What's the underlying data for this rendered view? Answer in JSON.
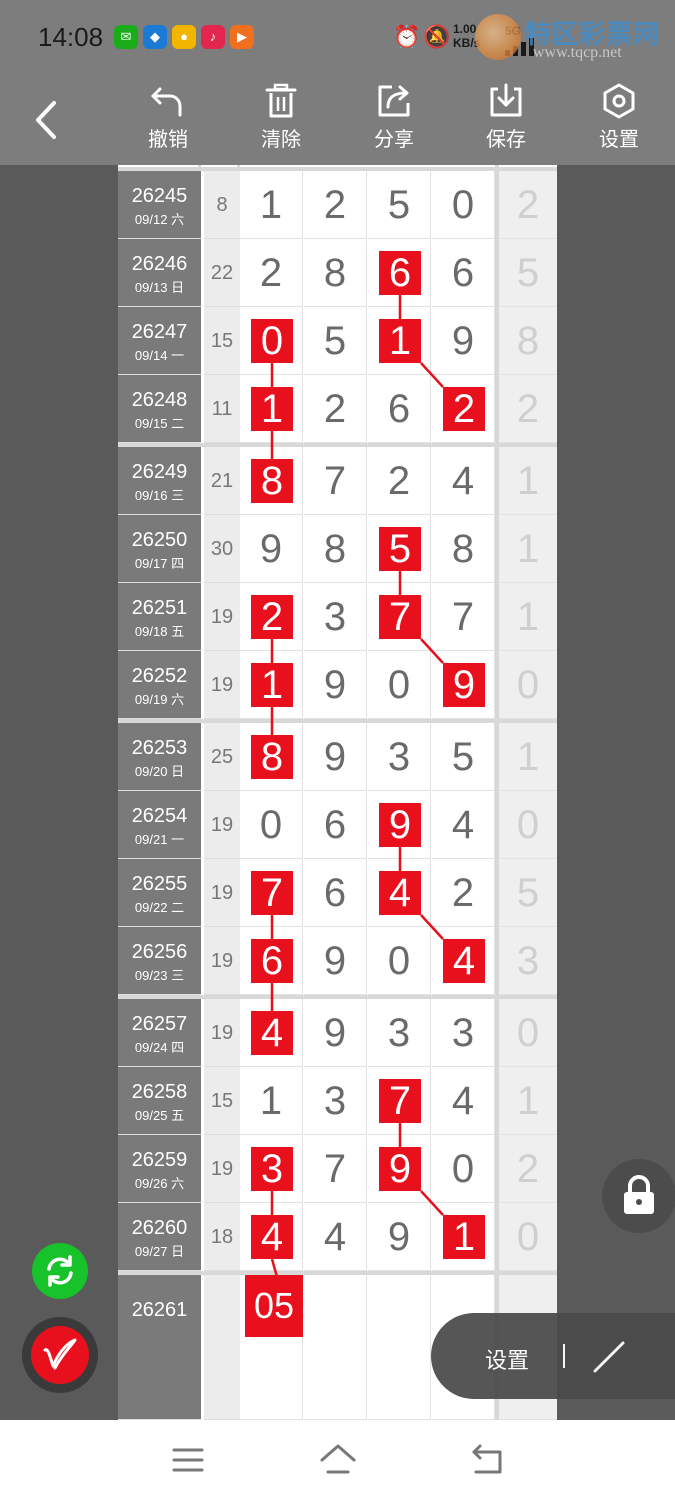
{
  "status_bar": {
    "time": "14:08",
    "app_icons": [
      {
        "name": "wechat-icon",
        "color": "#1aad19"
      },
      {
        "name": "app-blue-icon",
        "color": "#1a7ad6"
      },
      {
        "name": "app-yellow-icon",
        "color": "#f2b600"
      },
      {
        "name": "app-red-icon",
        "color": "#e2264d"
      },
      {
        "name": "app-orange-icon",
        "color": "#f07020"
      }
    ],
    "net_speed_value": "1.00",
    "net_speed_unit": "KB/s",
    "network": "5G"
  },
  "watermark": {
    "title": "特区彩票网",
    "url": "www.tqcp.net"
  },
  "toolbar": {
    "undo": "撤销",
    "clear": "清除",
    "share": "分享",
    "save": "保存",
    "settings": "设置"
  },
  "table": {
    "rows": [
      {
        "id": "26245",
        "date": "09/12 六",
        "sum": "8",
        "digits": [
          "1",
          "2",
          "5",
          "0"
        ],
        "extra": "2",
        "hl": []
      },
      {
        "id": "26246",
        "date": "09/13 日",
        "sum": "22",
        "digits": [
          "2",
          "8",
          "6",
          "6"
        ],
        "extra": "5",
        "hl": [
          2
        ]
      },
      {
        "id": "26247",
        "date": "09/14 一",
        "sum": "15",
        "digits": [
          "0",
          "5",
          "1",
          "9"
        ],
        "extra": "8",
        "hl": [
          0,
          2
        ]
      },
      {
        "id": "26248",
        "date": "09/15 二",
        "sum": "11",
        "digits": [
          "1",
          "2",
          "6",
          "2"
        ],
        "extra": "2",
        "hl": [
          0,
          3
        ]
      },
      {
        "id": "26249",
        "date": "09/16 三",
        "sum": "21",
        "digits": [
          "8",
          "7",
          "2",
          "4"
        ],
        "extra": "1",
        "hl": [
          0
        ]
      },
      {
        "id": "26250",
        "date": "09/17 四",
        "sum": "30",
        "digits": [
          "9",
          "8",
          "5",
          "8"
        ],
        "extra": "1",
        "hl": [
          2
        ]
      },
      {
        "id": "26251",
        "date": "09/18 五",
        "sum": "19",
        "digits": [
          "2",
          "3",
          "7",
          "7"
        ],
        "extra": "1",
        "hl": [
          0,
          2
        ]
      },
      {
        "id": "26252",
        "date": "09/19 六",
        "sum": "19",
        "digits": [
          "1",
          "9",
          "0",
          "9"
        ],
        "extra": "0",
        "hl": [
          0,
          3
        ]
      },
      {
        "id": "26253",
        "date": "09/20 日",
        "sum": "25",
        "digits": [
          "8",
          "9",
          "3",
          "5"
        ],
        "extra": "1",
        "hl": [
          0
        ]
      },
      {
        "id": "26254",
        "date": "09/21 一",
        "sum": "19",
        "digits": [
          "0",
          "6",
          "9",
          "4"
        ],
        "extra": "0",
        "hl": [
          2
        ]
      },
      {
        "id": "26255",
        "date": "09/22 二",
        "sum": "19",
        "digits": [
          "7",
          "6",
          "4",
          "2"
        ],
        "extra": "5",
        "hl": [
          0,
          2
        ]
      },
      {
        "id": "26256",
        "date": "09/23 三",
        "sum": "19",
        "digits": [
          "6",
          "9",
          "0",
          "4"
        ],
        "extra": "3",
        "hl": [
          0,
          3
        ]
      },
      {
        "id": "26257",
        "date": "09/24 四",
        "sum": "19",
        "digits": [
          "4",
          "9",
          "3",
          "3"
        ],
        "extra": "0",
        "hl": [
          0
        ]
      },
      {
        "id": "26258",
        "date": "09/25 五",
        "sum": "15",
        "digits": [
          "1",
          "3",
          "7",
          "4"
        ],
        "extra": "1",
        "hl": [
          2
        ]
      },
      {
        "id": "26259",
        "date": "09/26 六",
        "sum": "19",
        "digits": [
          "3",
          "7",
          "9",
          "0"
        ],
        "extra": "2",
        "hl": [
          0,
          2
        ]
      },
      {
        "id": "26260",
        "date": "09/27 日",
        "sum": "18",
        "digits": [
          "4",
          "4",
          "9",
          "1"
        ],
        "extra": "0",
        "hl": [
          0,
          3
        ]
      }
    ],
    "next_row": {
      "id": "26261",
      "prediction": "05"
    }
  },
  "floating": {
    "panel_label": "设置",
    "lock": "lock-icon",
    "refresh": "refresh-icon",
    "pen": "pen-icon"
  },
  "nav": {
    "menu": "menu-icon",
    "home": "home-icon",
    "back": "back-nav-icon"
  },
  "colors": {
    "highlight": "#e8101c",
    "toolbar": "#7d7d7d",
    "id_cell": "#7a7a7a",
    "green_button": "#18c22a"
  }
}
